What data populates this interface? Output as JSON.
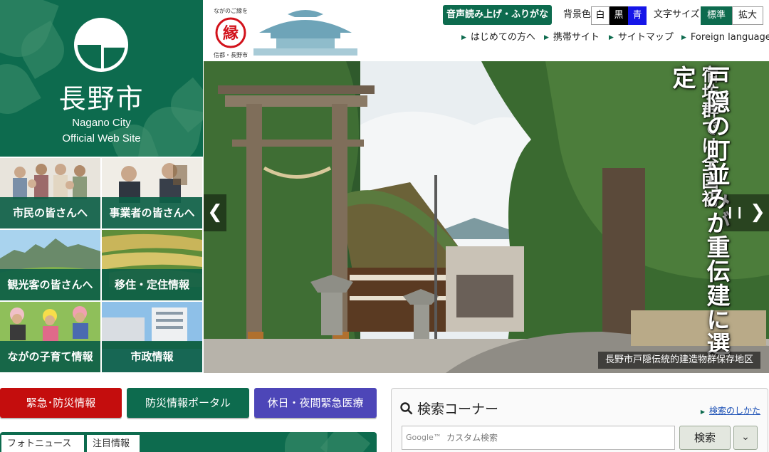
{
  "logo": {
    "city_name_jp": "長野市",
    "city_name_en": "Nagano City",
    "site_name_en": "Official Web Site"
  },
  "brand": {
    "tagline_top": "ながのご縁を",
    "seal_char": "縁",
    "tagline_bottom": "信都・長野市"
  },
  "utility": {
    "voice_button": "音声読み上げ・ふりがな",
    "bg_color_label": "背景色",
    "bg_options": [
      "白",
      "黒",
      "青"
    ],
    "text_size_label": "文字サイズ",
    "size_options": [
      "標準",
      "拡大"
    ]
  },
  "subnav": [
    "はじめての方へ",
    "携帯サイト",
    "サイトマップ",
    "Foreign language"
  ],
  "tiles": [
    {
      "label": "市民の皆さんへ"
    },
    {
      "label": "事業者の皆さんへ"
    },
    {
      "label": "観光客の皆さんへ"
    },
    {
      "label": "移住・定住情報"
    },
    {
      "label": "ながの子育て情報"
    },
    {
      "label": "市政情報"
    }
  ],
  "hero": {
    "headline_1": "宿坊群では全国初",
    "headline_2": "戸隠の町並みが重伝建に選定",
    "caption": "長野市戸隠伝統的建造物群保存地区",
    "prev": "❮",
    "pause": "❙❙",
    "next": "❯"
  },
  "quick_buttons": [
    {
      "label": "緊急･防災情報",
      "color": "#c40d0d"
    },
    {
      "label": "防災情報ポータル",
      "color": "#0d6b4e"
    },
    {
      "label": "休日・夜間緊急医療",
      "color": "#4d46b8"
    }
  ],
  "news": {
    "tabs": [
      "フォトニュース",
      "注目情報"
    ]
  },
  "search": {
    "title": "検索コーナー",
    "help_link": "検索のしかた",
    "placeholder": "カスタム検索",
    "google_mark": "Google™",
    "button": "検索",
    "more": "⌄"
  },
  "colors": {
    "brand_green": "#0d6b4e",
    "emergency_red": "#c40d0d",
    "medical_blue": "#4d46b8"
  }
}
